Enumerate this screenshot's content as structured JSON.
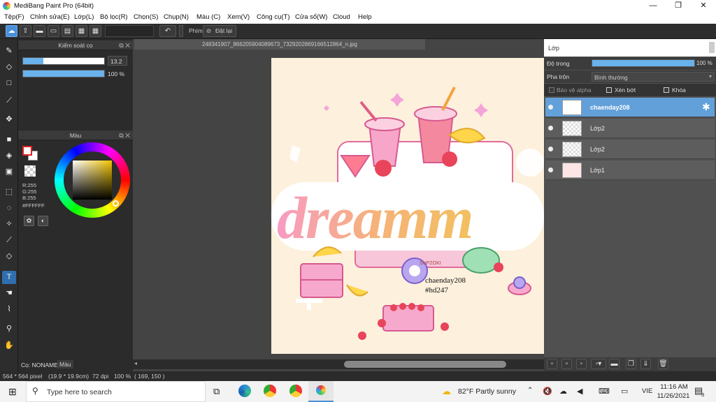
{
  "app": {
    "title": "MediBang Paint Pro (64bit)"
  },
  "window_controls": {
    "minimize": "—",
    "maximize": "❐",
    "close": "✕"
  },
  "menu": [
    "Tệp(F)",
    "Chỉnh sửa(E)",
    "Lớp(L)",
    "Bộ lọc(R)",
    "Chọn(S)",
    "Chụp(N)",
    "Màu (C)",
    "Xem(V)",
    "Công cụ(T)",
    "Cửa sổ(W)",
    "Cloud",
    "Help"
  ],
  "toolbar": {
    "key_label": "Phím",
    "reset_label": "Đặt lại"
  },
  "brush_control": {
    "title": "Kiểm soát cọ",
    "size_value": "13.2",
    "size_fraction": 0.25,
    "opacity_value": "100 %",
    "opacity_fraction": 1.0
  },
  "color_panel": {
    "title": "Màu",
    "r": "R:255",
    "g": "G:255",
    "b": "B:255",
    "hex": "#FFFFFF"
  },
  "left_tabs": {
    "brush_tab": "Cọ: NONAME",
    "color_tab": "Màu"
  },
  "document": {
    "tab": "248341907_866205904089673_7329202869166512864_n.jpg"
  },
  "canvas": {
    "watermark_line1": "chaenday208",
    "watermark_line2": "#hd247",
    "art_text": "dreamm",
    "box_label": "SUPZOKI"
  },
  "layers_panel": {
    "title": "Lớp",
    "opacity_label": "Độ trong",
    "opacity_value": "100 %",
    "opacity_fraction": 1.0,
    "blend_label": "Pha trộn",
    "blend_value": "Bình thường",
    "protect_alpha": "Bảo vệ alpha",
    "clipping": "Xén bớt",
    "lock": "Khóa",
    "layers": [
      {
        "name": "chaenday208",
        "selected": true
      },
      {
        "name": "Lớp2",
        "selected": false
      },
      {
        "name": "Lớp2",
        "selected": false
      },
      {
        "name": "Lớp1",
        "selected": false
      }
    ]
  },
  "status": {
    "size": "564 * 564 pixel",
    "physical": "(19.9 * 19.9cm)",
    "dpi": "72 dpi",
    "zoom": "100 %",
    "coords": "( 169, 150 )"
  },
  "taskbar": {
    "search_placeholder": "Type here to search",
    "weather": "82°F  Partly sunny",
    "lang": "VIE",
    "time": "11:16 AM",
    "date": "11/26/2021",
    "notifications": "3"
  },
  "colors": {
    "accent": "#62a0da",
    "canvas_bg": "#fdf0dd",
    "primary_color": "#e02020"
  }
}
